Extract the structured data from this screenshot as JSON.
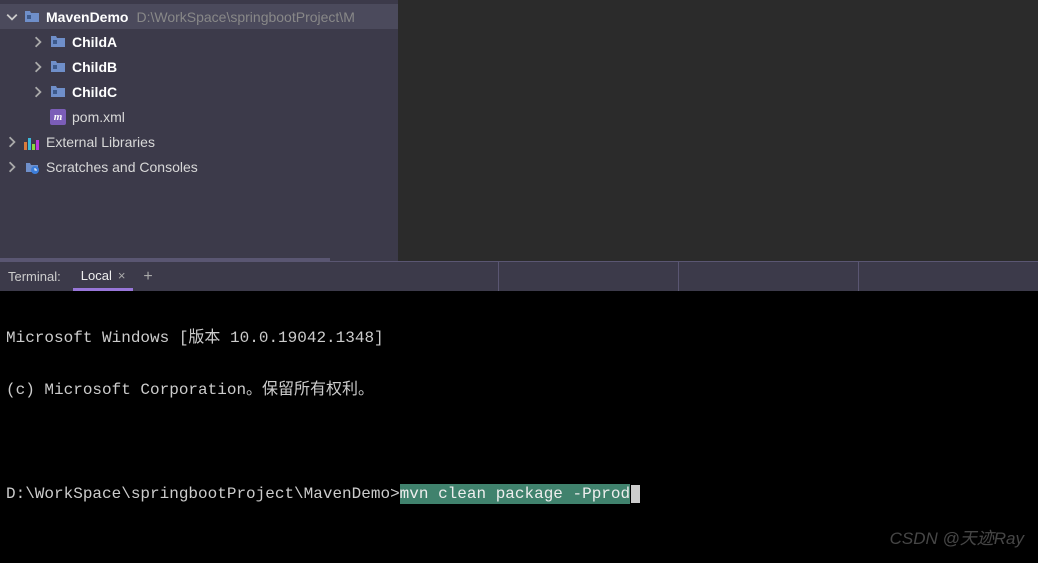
{
  "project": {
    "root_name": "MavenDemo",
    "root_path": "D:\\WorkSpace\\springbootProject\\M",
    "children": [
      {
        "name": "ChildA"
      },
      {
        "name": "ChildB"
      },
      {
        "name": "ChildC"
      }
    ],
    "pom_file": "pom.xml",
    "external_libs": "External Libraries",
    "scratches": "Scratches and Consoles"
  },
  "terminal": {
    "label": "Terminal:",
    "tab_name": "Local",
    "line1": "Microsoft Windows [版本 10.0.19042.1348]",
    "line2": "(c) Microsoft Corporation。保留所有权利。",
    "prompt": "D:\\WorkSpace\\springbootProject\\MavenDemo>",
    "command": "mvn clean package -Pprod"
  },
  "watermark": "CSDN @天迹Ray"
}
